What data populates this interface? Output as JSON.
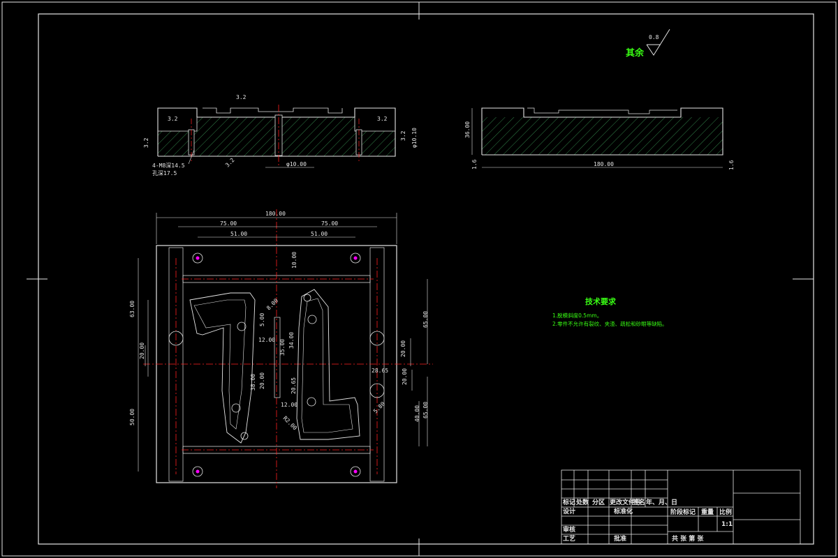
{
  "roughness": {
    "other_label": "其余",
    "value": "0.8"
  },
  "section_view": {
    "dims": [
      "3.2",
      "3.2",
      "3.2",
      "3.2",
      "3.2",
      "3.2"
    ],
    "hole_note_1": "φ10.10",
    "hole_note_2": "φ10.00",
    "bolt_note_1": "4-M8深14.5",
    "bolt_note_2": "孔深17.5",
    "bottom_rough": "3.2"
  },
  "side_view": {
    "height": "36.00",
    "width": "180.00",
    "left_rough": "1.6",
    "right_rough": "1.6"
  },
  "plan_view": {
    "overall_width": "180.00",
    "left_half": "75.00",
    "right_half": "75.00",
    "hole_left": "51.00",
    "hole_right": "51.00",
    "left_upper": "63.00",
    "left_lower": "50.00",
    "left_mid": "20.00",
    "right_upper": "65.00",
    "right_mid": "20.00",
    "right_lower_1": "20.00",
    "right_lower_2": "65.00",
    "right_lower_3": "40.00",
    "center_top": "10.00",
    "dim_a": "8.00",
    "dim_b": "12.00",
    "dim_c": "35.00",
    "dim_d": "34.00",
    "dim_e": "5.00",
    "dim_f": "20.65",
    "dim_g": "12.00",
    "dim_h": "20.00",
    "dim_i": "38.00",
    "dim_j": "R2.00",
    "dim_k": "28.65",
    "dim_l": "5.80"
  },
  "tech_req": {
    "title": "技术要求",
    "line1": "1.脱模斜度0.5mm。",
    "line2": "2.零件不允许有裂纹、夹渣、疏松和砂眼等缺陷。"
  },
  "title_block": {
    "h1": "标记",
    "h2": "处数",
    "h3": "分区",
    "h4": "更改文件号",
    "h5": "签名",
    "h6": "年、月、日",
    "design": "设计",
    "standard": "标准化",
    "check": "审核",
    "process": "工艺",
    "approve": "批准",
    "stage": "阶段标记",
    "weight": "重量",
    "scale": "比例",
    "scale_value": "1:1",
    "sheets": "共  张  第  张"
  },
  "colors": {
    "line": "#e6e6e6",
    "hatch": "#3fa35c",
    "center": "#ff2020",
    "text": "#39ff14",
    "hole": "#ff00ff"
  }
}
